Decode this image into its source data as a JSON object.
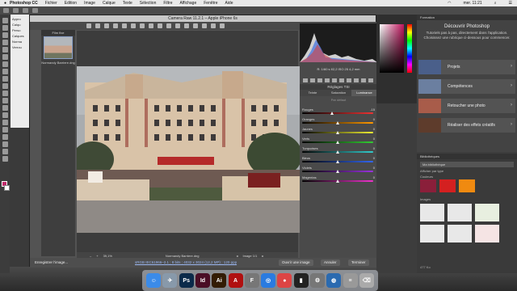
{
  "menubar": {
    "app": "Photoshop CC",
    "items": [
      "Fichier",
      "Edition",
      "Image",
      "Calque",
      "Texte",
      "Sélection",
      "Filtre",
      "Affichage",
      "Fenêtre",
      "Aide"
    ],
    "clock": "mer. 11:21"
  },
  "app_frame": {
    "lines": [
      "Appro",
      "Calqu",
      "Perso",
      "Calques",
      "Norma",
      "Verrou"
    ]
  },
  "camera_raw": {
    "title": "Camera Raw 11.2.1  –  Apple iPhone 6s",
    "filmstrip_header": "Film fixe",
    "thumb_name": "Normandy Barriere.dng",
    "zoom": "39,1%",
    "file_name": "Normandy Barriere.dng",
    "image_count": "Image 1/1",
    "save_link": "Enregistrer l'image...",
    "info_link": "sRGB IEC61966–2.1 ; 8 bits ; 4032 x 3024 (12,2 MP) ; 120 ppp",
    "buttons": {
      "open": "Ouvrir une image",
      "cancel": "Annuler",
      "done": "Terminer"
    },
    "readout": {
      "line1": "R: 1/60 s   f/2,2   ISO 25   4,2 mm"
    },
    "panel_title": "Réglages TSI",
    "subtabs": [
      "Teinte",
      "Saturation",
      "Luminance"
    ],
    "active_subtab": 2,
    "default_label": "Par défaut",
    "sliders": [
      {
        "label": "Rouges",
        "value": "-15",
        "level": -15,
        "colors": [
          "#000",
          "#e33"
        ]
      },
      {
        "label": "Oranges",
        "value": "0",
        "level": 0,
        "colors": [
          "#000",
          "#f90"
        ]
      },
      {
        "label": "Jaunes",
        "value": "0",
        "level": 0,
        "colors": [
          "#000",
          "#ee3"
        ]
      },
      {
        "label": "Verts",
        "value": "0",
        "level": 0,
        "colors": [
          "#000",
          "#3c3"
        ]
      },
      {
        "label": "Turquoises",
        "value": "0",
        "level": 0,
        "colors": [
          "#000",
          "#3cc"
        ]
      },
      {
        "label": "Bleus",
        "value": "0",
        "level": 0,
        "colors": [
          "#000",
          "#36e"
        ]
      },
      {
        "label": "Violets",
        "value": "0",
        "level": 0,
        "colors": [
          "#000",
          "#93d"
        ]
      },
      {
        "label": "Magentas",
        "value": "0",
        "level": 0,
        "colors": [
          "#000",
          "#e3c"
        ]
      }
    ]
  },
  "learn": {
    "tab": "Formation",
    "title": "Découvrir Photoshop",
    "desc": "Tutoriels pas à pas, directement dans l'application. Choisissez une rubrique ci-dessous pour commencer.",
    "cards": [
      {
        "label": "Projets",
        "color": "#4a5f8a"
      },
      {
        "label": "Compétences",
        "color": "#6b7fa0"
      },
      {
        "label": "Retoucher une photo",
        "color": "#a85c4a"
      },
      {
        "label": "Réaliser des effets créatifs",
        "color": "#5e3c2c"
      }
    ]
  },
  "libraries": {
    "tab": "Bibliothèques",
    "select": "Ma bibliothèque",
    "filter": "Afficher par type",
    "colors_header": "Couleurs",
    "images_header": "Images",
    "swatches": [
      "#8a1f3a",
      "#d42020",
      "#f08a10"
    ],
    "footer": "477 Ko"
  },
  "dock": {
    "apps": [
      {
        "name": "finder",
        "glyph": "☺",
        "color": "#3b8be8"
      },
      {
        "name": "launchpad",
        "glyph": "✈",
        "color": "#8899aa"
      },
      {
        "name": "photoshop",
        "glyph": "Ps",
        "color": "#0b2a4a"
      },
      {
        "name": "indesign",
        "glyph": "Id",
        "color": "#4a0e26"
      },
      {
        "name": "illustrator",
        "glyph": "Ai",
        "color": "#331c04"
      },
      {
        "name": "acrobat",
        "glyph": "A",
        "color": "#b01010"
      },
      {
        "name": "fontbook",
        "glyph": "F",
        "color": "#777"
      },
      {
        "name": "safari",
        "glyph": "◎",
        "color": "#2a7be0"
      },
      {
        "name": "chrome",
        "glyph": "●",
        "color": "#d44"
      },
      {
        "name": "terminal",
        "glyph": "▮",
        "color": "#222"
      },
      {
        "name": "system-prefs",
        "glyph": "⚙",
        "color": "#777"
      },
      {
        "name": "network",
        "glyph": "◍",
        "color": "#2a6ab0"
      },
      {
        "name": "notes",
        "glyph": "≡",
        "color": "#999"
      },
      {
        "name": "trash",
        "glyph": "⌫",
        "color": "#aaa"
      }
    ]
  }
}
